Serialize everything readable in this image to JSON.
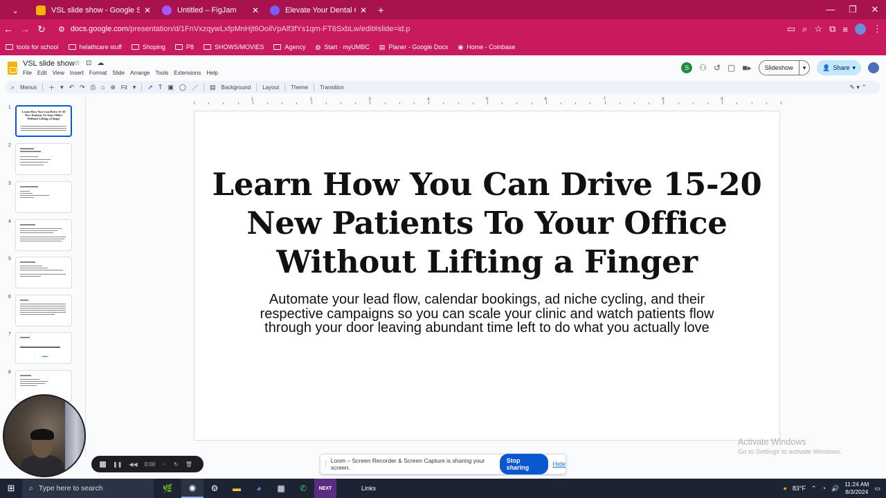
{
  "browser": {
    "tabs": [
      {
        "label": "VSL slide show - Google Sli",
        "icon": "slides-icon",
        "color": "#f4b400",
        "active": true
      },
      {
        "label": "Untitled – FigJam",
        "icon": "figma-icon",
        "color": "#a259ff",
        "active": false
      },
      {
        "label": "Elevate Your Dental Clinic Mark",
        "icon": "gear-icon",
        "color": "#7a5cff",
        "active": false
      }
    ],
    "new_tab": "+",
    "url_main": "docs.google.com",
    "url_path": "/presentation/d/1FnVxzqywLxfpMnHjt6OoilVpAlf3fYs1qm-FT6SxbLw/edit#slide=id.p",
    "bookmarks": [
      "tools for school",
      "helathcare stuff",
      "Shoping",
      "P8",
      "SHOWS/MOVIES",
      "Agency",
      "Start · myUMBC",
      "Planer - Google Docs",
      "Home - Coinbase"
    ]
  },
  "docs": {
    "title": "VSL slide show",
    "menus": [
      "File",
      "Edit",
      "View",
      "Insert",
      "Format",
      "Slide",
      "Arrange",
      "Tools",
      "Extensions",
      "Help"
    ],
    "avatar_letter": "S",
    "slideshow_label": "Slideshow",
    "share_label": "Share",
    "toolbar": {
      "menus_label": "Menus",
      "zoom": "Fit",
      "background": "Background",
      "layout": "Layout",
      "theme": "Theme",
      "transition": "Transition"
    }
  },
  "filmstrip": {
    "slides": [
      "1",
      "2",
      "3",
      "4",
      "5",
      "6",
      "7",
      "8"
    ],
    "first_thumb_title": "Learn How You Can Drive 15-20 New Patients To Your Office Without Lifting a Finger"
  },
  "ruler": [
    "1",
    "2",
    "3",
    "4",
    "5",
    "6",
    "7",
    "8",
    "9"
  ],
  "slide": {
    "title_lines": [
      "Learn How You Can Drive 15-20",
      "New Patients To Your Office",
      "Without Lifting a Finger"
    ],
    "subtitle_lines": [
      "Automate your lead flow, calendar bookings, ad niche cycling, and their",
      "respective campaigns so you can scale your clinic and watch patients flow",
      "through your door leaving abundant time left to do what you actually love"
    ]
  },
  "activate_windows": {
    "line1": "Activate Windows",
    "line2": "Go to Settings to activate Windows."
  },
  "loom": {
    "timer": "0:00",
    "share_message": "Loom – Screen Recorder & Screen Capture is sharing your screen.",
    "stop_sharing": "Stop sharing",
    "hide": "Hide"
  },
  "taskbar": {
    "search_placeholder": "Type here to search",
    "links_label": "Links",
    "weather": "83°F",
    "time": "11:24 AM",
    "date": "8/3/2024"
  }
}
